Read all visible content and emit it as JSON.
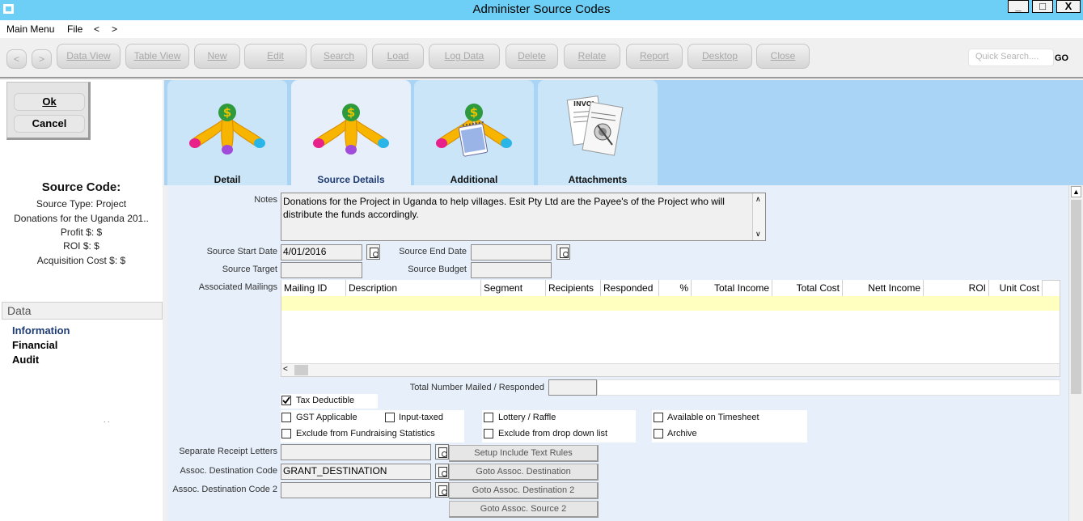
{
  "window": {
    "title": "Administer Source Codes",
    "controls": [
      "_",
      "□",
      "X"
    ]
  },
  "menu": {
    "items": [
      "Main Menu",
      "File",
      "<",
      ">"
    ]
  },
  "toolbar": {
    "nav_back": "<",
    "nav_forward": ">",
    "buttons": [
      "Data View",
      "Table View",
      "New",
      "Edit",
      "Search",
      "Load",
      "Log Data",
      "Delete",
      "Relate",
      "Report",
      "Desktop",
      "Close"
    ],
    "search_placeholder": "Quick Search....",
    "go_label": "GO"
  },
  "dialog": {
    "ok_label": "Ok",
    "cancel_label": "Cancel"
  },
  "summary": {
    "heading": "Source Code:",
    "source_type": "Source Type: Project",
    "description": "Donations for the Uganda 201..",
    "profit": "Profit $: $",
    "roi": "ROI $: $",
    "acquisition_cost": "Acquisition Cost $: $"
  },
  "data_section": {
    "heading": "Data",
    "items": [
      "Information",
      "Financial",
      "Audit"
    ],
    "stray_text": ". ."
  },
  "tabs": [
    {
      "label": "Detail",
      "icon": "money-tree-icon"
    },
    {
      "label": "Source Details",
      "icon": "money-tree-icon",
      "active": true
    },
    {
      "label": "Additional",
      "icon": "money-tree-notepad-icon"
    },
    {
      "label": "Attachments",
      "icon": "paperclip-documents-icon"
    }
  ],
  "form": {
    "notes_label": "Notes",
    "notes_value": "Donations for the Project in Uganda to help villages. Esit Pty Ltd are the Payee's of the Project who will distribute the funds accordingly.",
    "start_date_label": "Source Start Date",
    "start_date_value": "4/01/2016",
    "end_date_label": "Source End Date",
    "end_date_value": "",
    "target_label": "Source Target",
    "target_value": "",
    "budget_label": "Source Budget",
    "budget_value": "",
    "mailings_label": "Associated Mailings",
    "grid_columns": [
      "Mailing ID",
      "Description",
      "Segment",
      "Recipients",
      "Responded",
      "%",
      "Total Income",
      "Total Cost",
      "Nett Income",
      "ROI",
      "Unit Cost"
    ],
    "total_label": "Total Number Mailed / Responded",
    "checkboxes": {
      "tax_deductible": {
        "label": "Tax Deductible",
        "checked": true
      },
      "gst_applicable": {
        "label": "GST Applicable",
        "checked": false
      },
      "input_taxed": {
        "label": "Input-taxed",
        "checked": false
      },
      "lottery_raffle": {
        "label": "Lottery / Raffle",
        "checked": false
      },
      "available_timesheet": {
        "label": "Available on Timesheet",
        "checked": false
      },
      "exclude_fundraising": {
        "label": "Exclude from Fundraising Statistics",
        "checked": false
      },
      "exclude_dropdown": {
        "label": "Exclude from drop down list",
        "checked": false
      },
      "archive": {
        "label": "Archive",
        "checked": false
      }
    },
    "separate_receipt_label": "Separate Receipt Letters",
    "separate_receipt_value": "",
    "dest_code_label": "Assoc. Destination Code",
    "dest_code_value": "GRANT_DESTINATION",
    "dest_code2_label": "Assoc. Destination Code 2",
    "dest_code2_value": "",
    "buttons": {
      "setup_include": "Setup Include Text Rules",
      "goto_dest": "Goto Assoc. Destination",
      "goto_dest2": "Goto Assoc. Destination 2",
      "goto_source2": "Goto Assoc. Source 2"
    }
  }
}
